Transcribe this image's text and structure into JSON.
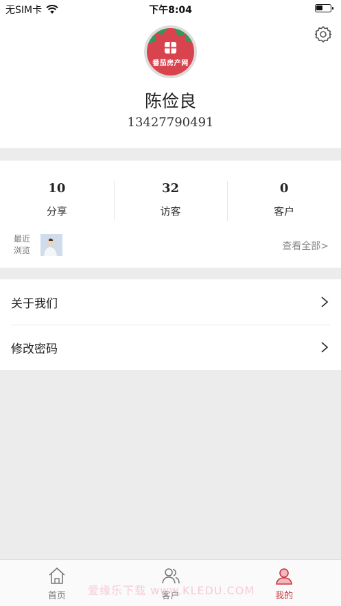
{
  "status_bar": {
    "carrier": "无SIM卡",
    "time": "下午8:04"
  },
  "profile": {
    "avatar_caption": "番茄房产网",
    "name": "陈俭良",
    "phone": "13427790491"
  },
  "stats": [
    {
      "value": "10",
      "label": "分享"
    },
    {
      "value": "32",
      "label": "访客"
    },
    {
      "value": "0",
      "label": "客户"
    }
  ],
  "recent": {
    "label": "最近浏览",
    "view_all": "查看全部>"
  },
  "menu": [
    {
      "label": "关于我们"
    },
    {
      "label": "修改密码"
    }
  ],
  "tabs": [
    {
      "label": "首页",
      "icon": "home-icon",
      "active": false
    },
    {
      "label": "客户",
      "icon": "users-icon",
      "active": false
    },
    {
      "label": "我的",
      "icon": "profile-icon",
      "active": true
    }
  ],
  "watermark": "爱缘乐下载 www.KLEDU.COM",
  "colors": {
    "accent": "#c9343f",
    "brand_red": "#d9434e",
    "background": "#ececec"
  }
}
